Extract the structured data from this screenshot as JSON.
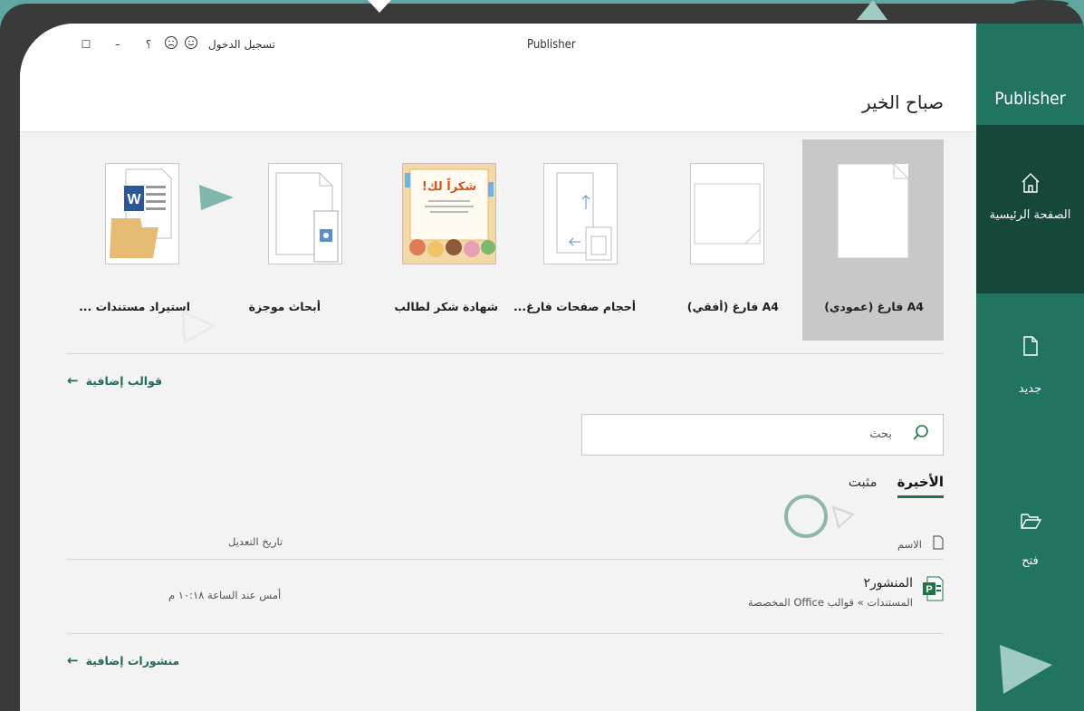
{
  "window": {
    "title": "Publisher",
    "sign_in": "تسجيل الدخول",
    "help": "؟",
    "minimize": "–",
    "restore": "☐"
  },
  "greeting": "صباح الخير",
  "templates": [
    {
      "label": "A4 فارغ (عمودي)",
      "selected": true
    },
    {
      "label": "A4 فارغ (أفقي)",
      "selected": false
    },
    {
      "label": "أحجام صفحات فارغ...",
      "selected": false
    },
    {
      "label": "شهادة شكر لطالب",
      "selected": false
    },
    {
      "label": "أبحاث موجزة",
      "selected": false
    },
    {
      "label": "استيراد مستندات ...",
      "selected": false
    }
  ],
  "certificate_text": "شكراً لك!",
  "more_templates": "قوالب إضافية",
  "search": {
    "placeholder": "بحث"
  },
  "tabs": {
    "recent": "الأخيرة",
    "pinned": "مثبت"
  },
  "columns": {
    "name": "الاسم",
    "modified": "تاريخ التعديل"
  },
  "recent_files": [
    {
      "name": "المنشور٢",
      "path": "المستندات » قوالب Office المخصصة",
      "modified": "أمس عند الساعة ١٠:١٨ م"
    }
  ],
  "more_publications": "منشورات إضافية",
  "sidebar": {
    "app_name": "Publisher",
    "items": [
      {
        "label": "الصفحة الرئيسية",
        "icon": "home-icon",
        "active": true
      },
      {
        "label": "جديد",
        "icon": "new-document-icon",
        "active": false
      },
      {
        "label": "فتح",
        "icon": "open-folder-icon",
        "active": false
      }
    ]
  },
  "colors": {
    "accent": "#217346",
    "sidebar": "#217560",
    "sidebar_active": "#15473b",
    "background": "#5fa8a2"
  }
}
